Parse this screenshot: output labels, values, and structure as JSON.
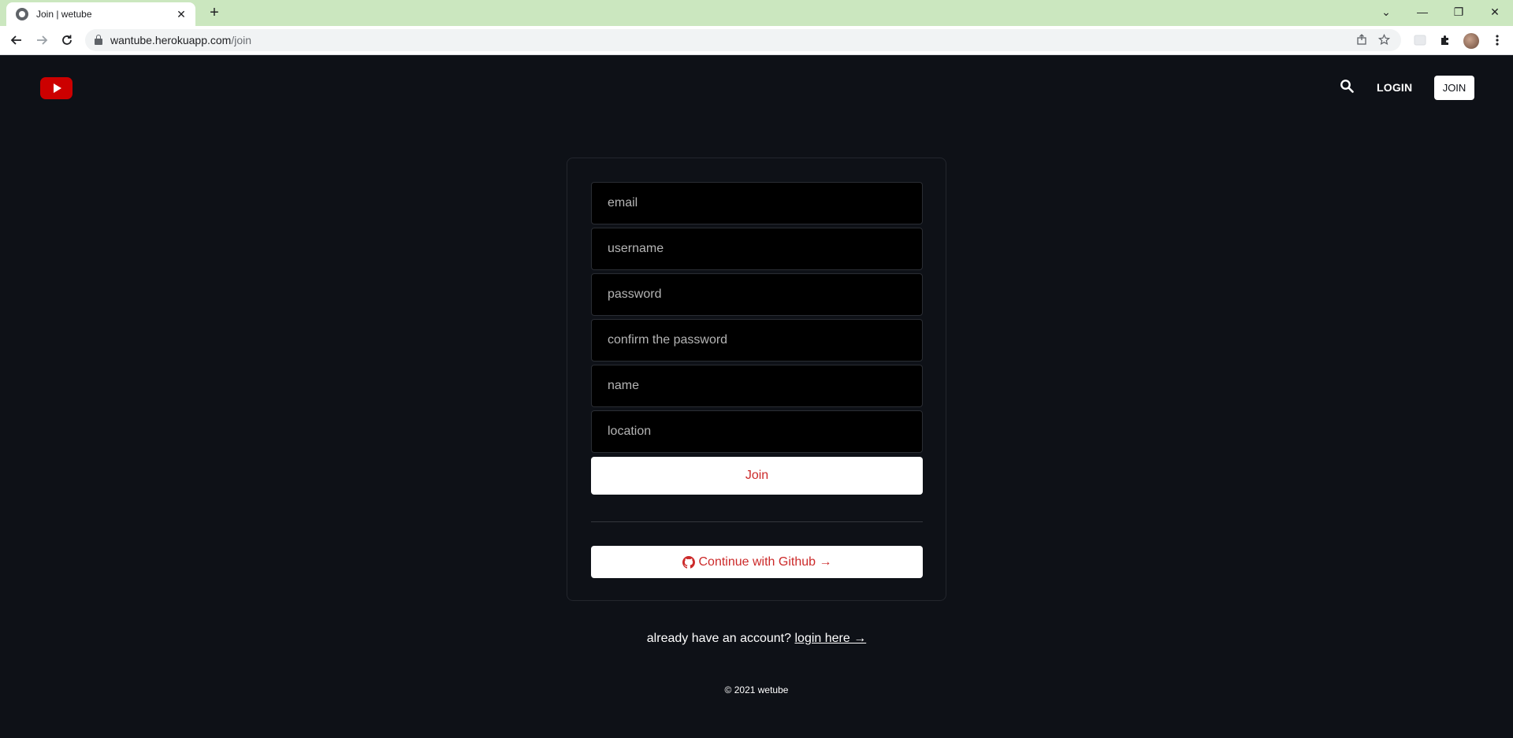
{
  "browser": {
    "tab_title": "Join | wetube",
    "tab_close": "✕",
    "new_tab": "+",
    "url_host": "wantube.herokuapp.com",
    "url_path": "/join",
    "window_controls": [
      "⌄",
      "—",
      "❐",
      "✕"
    ]
  },
  "header": {
    "logo_icon": "youtube-play-icon",
    "search_icon": "search-icon",
    "login_label": "LOGIN",
    "join_label": "JOIN"
  },
  "form": {
    "fields": [
      {
        "placeholder": "email",
        "type": "email"
      },
      {
        "placeholder": "username",
        "type": "text"
      },
      {
        "placeholder": "password",
        "type": "password"
      },
      {
        "placeholder": "confirm the password",
        "type": "password"
      },
      {
        "placeholder": "name",
        "type": "text"
      },
      {
        "placeholder": "location",
        "type": "text"
      }
    ],
    "submit_label": "Join",
    "github_label": "Continue with Github →"
  },
  "switch": {
    "prompt": "already have an account?",
    "link_label": "login here →"
  },
  "footer": {
    "copyright": "© 2021 wetube"
  },
  "colors": {
    "page_bg": "#0e1117",
    "brand_red": "#cc0000",
    "accent_text_red": "#cc2a2a",
    "tabstrip_green": "#cbe7bf"
  }
}
